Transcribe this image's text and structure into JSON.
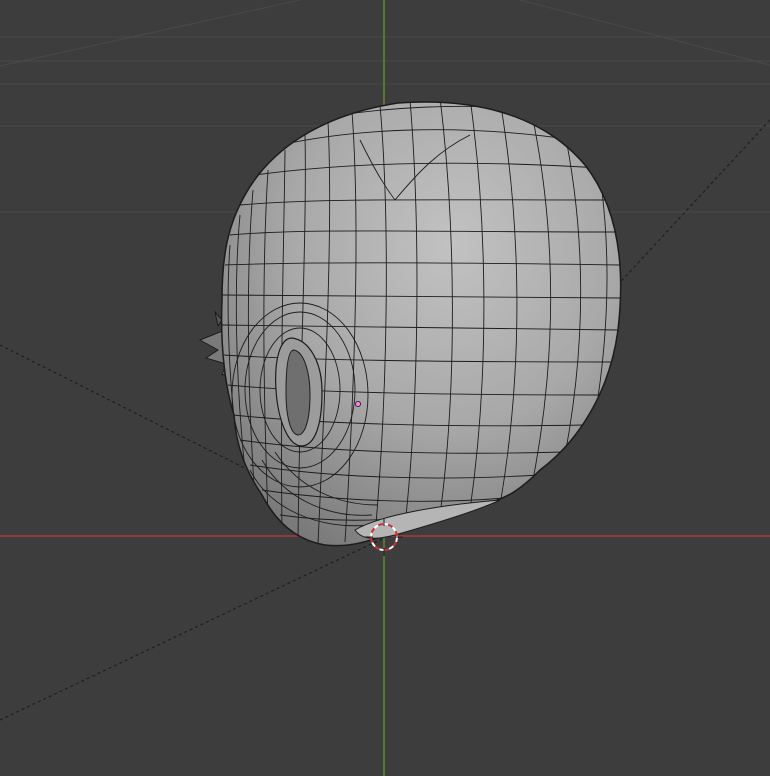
{
  "viewport": {
    "kind": "3d-viewport",
    "background_color": "#3d3d3d",
    "grid_color": "#4a4a4a",
    "x_axis_color": "#c4353b",
    "y_axis_color": "#6a9a2a",
    "mesh_fill_color": "#a9a9a9",
    "wire_color": "#1c1c1c",
    "origin_color": "#ff7fe0"
  },
  "scene": {
    "object": "head-mesh",
    "mode": "wireframe-overlay",
    "items": [
      "grid-floor",
      "x-axis-line",
      "y-axis-line",
      "head-mesh",
      "object-origin",
      "3d-cursor",
      "dashed-relationship-lines"
    ]
  }
}
